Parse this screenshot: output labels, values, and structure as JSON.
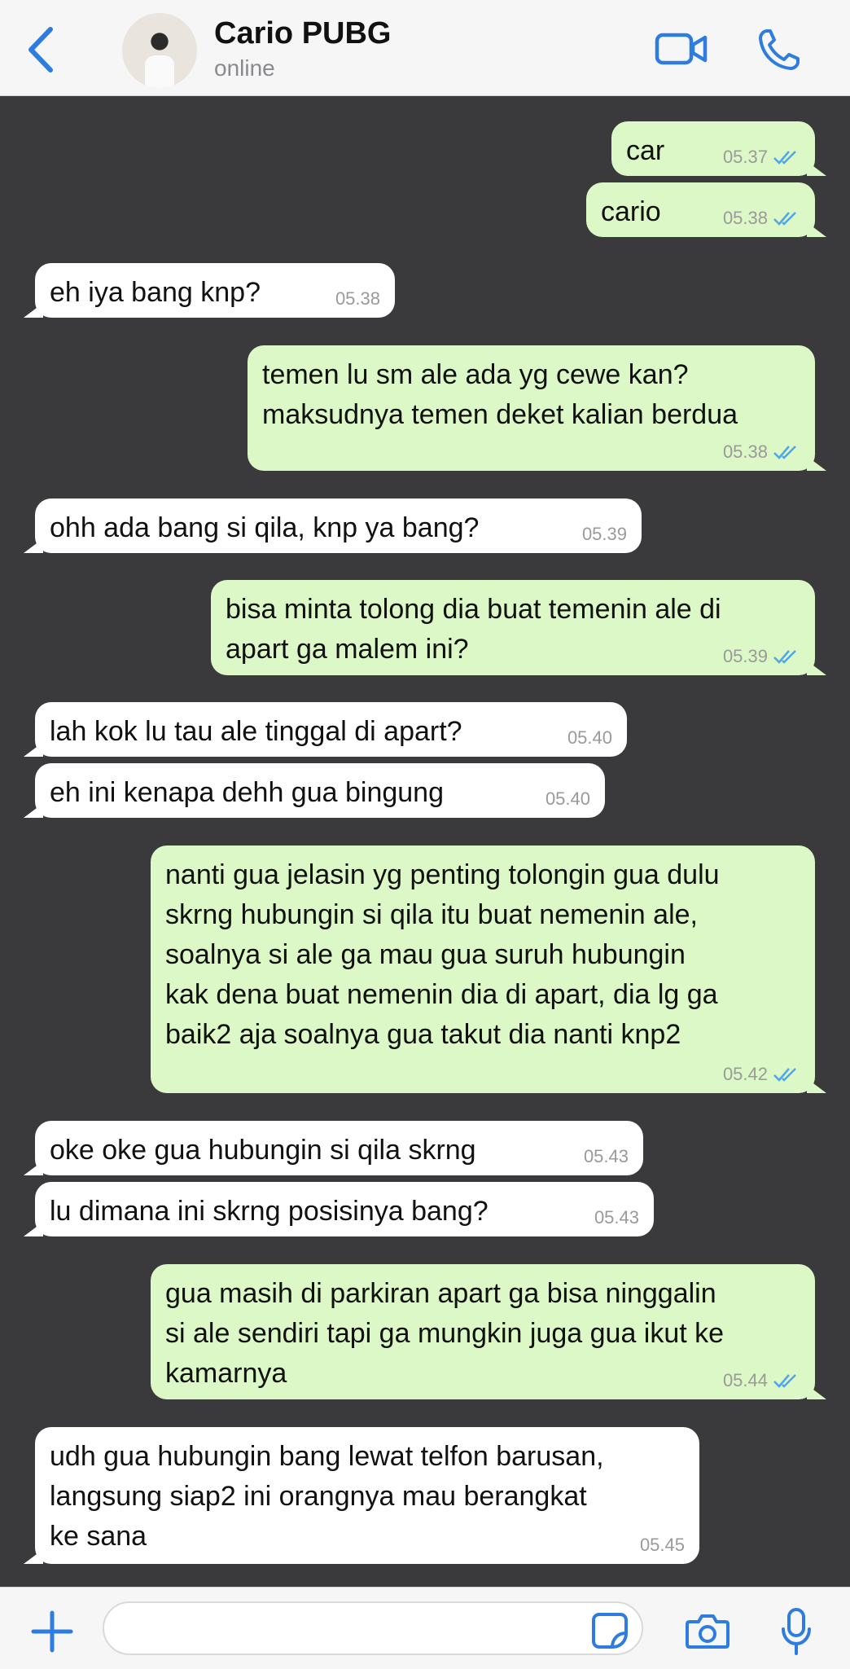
{
  "header": {
    "contact_name": "Cario PUBG",
    "status": "online"
  },
  "messages": [
    {
      "dir": "out",
      "text": "car",
      "time": "05.37",
      "read": true
    },
    {
      "dir": "out",
      "text": "cario",
      "time": "05.38",
      "read": true
    },
    {
      "dir": "in",
      "text": "eh iya bang knp?",
      "time": "05.38"
    },
    {
      "dir": "out",
      "text": "temen lu sm ale ada yg cewe kan?\nmaksudnya temen deket kalian berdua",
      "time": "05.38",
      "read": true
    },
    {
      "dir": "in",
      "text": "ohh ada bang si qila, knp ya bang?",
      "time": "05.39"
    },
    {
      "dir": "out",
      "text": "bisa minta tolong dia buat temenin ale di\napart ga malem ini?",
      "time": "05.39",
      "read": true
    },
    {
      "dir": "in",
      "text": "lah kok lu tau ale tinggal di apart?",
      "time": "05.40"
    },
    {
      "dir": "in",
      "text": "eh ini kenapa dehh gua bingung",
      "time": "05.40"
    },
    {
      "dir": "out",
      "text": "nanti gua jelasin yg penting tolongin gua dulu\nskrng hubungin si qila itu buat nemenin ale,\nsoalnya si ale ga mau gua suruh hubungin\nkak dena buat nemenin dia di apart, dia lg ga\nbaik2 aja soalnya gua takut dia nanti knp2",
      "time": "05.42",
      "read": true
    },
    {
      "dir": "in",
      "text": "oke oke gua hubungin si qila skrng",
      "time": "05.43"
    },
    {
      "dir": "in",
      "text": "lu dimana ini skrng posisinya bang?",
      "time": "05.43"
    },
    {
      "dir": "out",
      "text": "gua masih di parkiran apart ga bisa ninggalin\nsi ale sendiri tapi ga mungkin juga gua ikut ke\nkamarnya",
      "time": "05.44",
      "read": true
    },
    {
      "dir": "in",
      "text": "udh gua hubungin bang lewat telfon barusan,\nlangsung siap2 ini orangnya mau berangkat\nke sana",
      "time": "05.45"
    }
  ],
  "composer": {
    "placeholder": "",
    "icons": [
      "plus-icon",
      "sticker-icon",
      "camera-icon",
      "microphone-icon"
    ]
  },
  "colors": {
    "accent": "#2f7ce0",
    "outgoing_bubble": "#dcf8c6",
    "incoming_bubble": "#ffffff",
    "chat_background": "#3a393c",
    "read_ticks": "#4fa6e8"
  }
}
